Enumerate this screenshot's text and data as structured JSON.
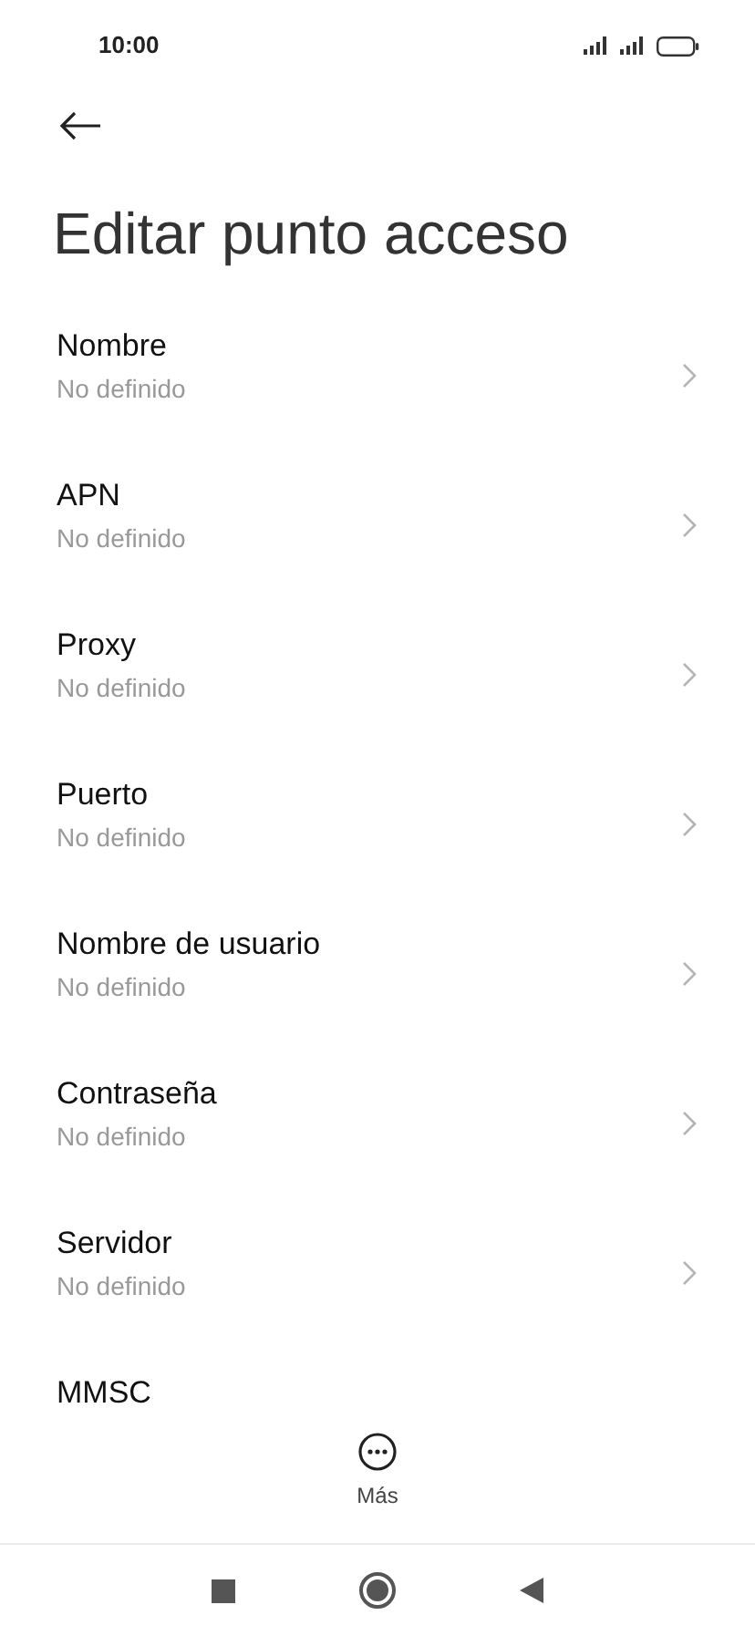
{
  "status_bar": {
    "time": "10:00"
  },
  "title": "Editar punto acceso",
  "items": [
    {
      "label": "Nombre",
      "value": "No definido"
    },
    {
      "label": "APN",
      "value": "No definido"
    },
    {
      "label": "Proxy",
      "value": "No definido"
    },
    {
      "label": "Puerto",
      "value": "No definido"
    },
    {
      "label": "Nombre de usuario",
      "value": "No definido"
    },
    {
      "label": "Contraseña",
      "value": "No definido"
    },
    {
      "label": "Servidor",
      "value": "No definido"
    },
    {
      "label": "MMSC"
    }
  ],
  "more_button": {
    "label": "Más"
  }
}
